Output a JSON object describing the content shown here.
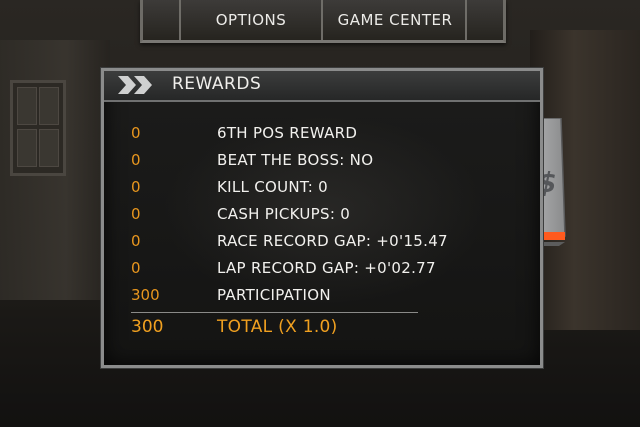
{
  "menu": {
    "options": "OPTIONS",
    "game_center": "GAME CENTER"
  },
  "rewards": {
    "title": "REWARDS",
    "rows": [
      {
        "value": "0",
        "label": "6TH POS REWARD"
      },
      {
        "value": "0",
        "label": "BEAT THE BOSS: NO"
      },
      {
        "value": "0",
        "label": "KILL COUNT: 0"
      },
      {
        "value": "0",
        "label": "CASH PICKUPS: 0"
      },
      {
        "value": "0",
        "label": "RACE RECORD GAP: +0'15.47"
      },
      {
        "value": "0",
        "label": "LAP RECORD GAP: +0'02.77"
      },
      {
        "value": "300",
        "label": "PARTICIPATION"
      }
    ],
    "total": {
      "value": "300",
      "label": "TOTAL (X 1.0)"
    }
  },
  "cash_tab": {
    "symbol": "$"
  },
  "colors": {
    "accent_orange": "#e8961e",
    "text_white": "#f2f1ee",
    "tab_stripe": "#ff5a1e"
  }
}
